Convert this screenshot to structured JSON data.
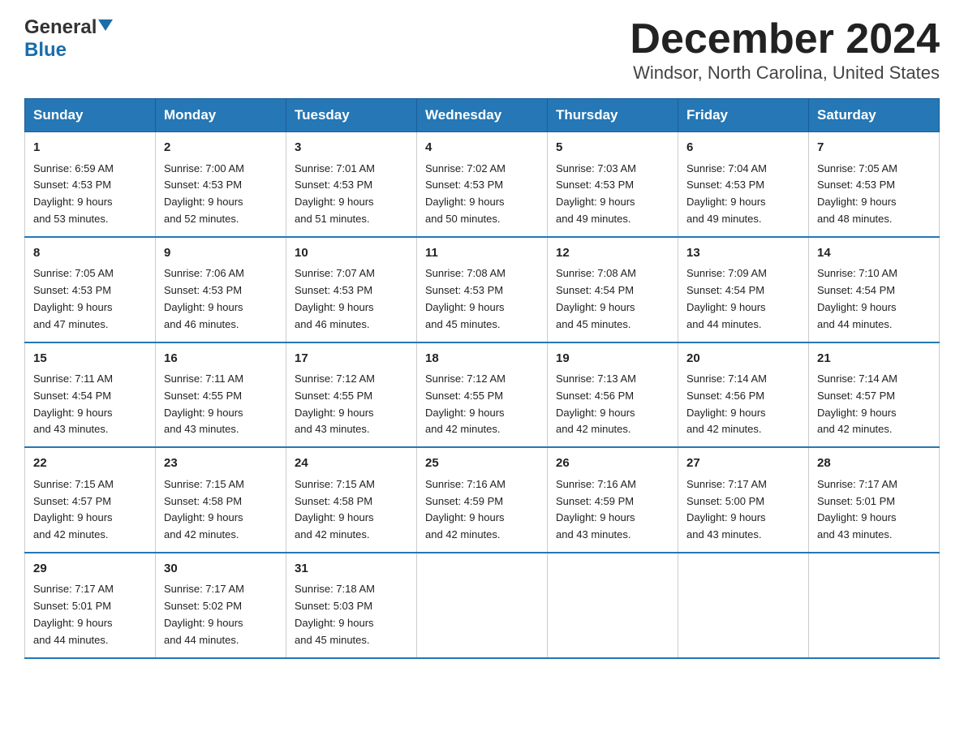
{
  "header": {
    "logo_general": "General",
    "logo_blue": "Blue",
    "title": "December 2024",
    "subtitle": "Windsor, North Carolina, United States"
  },
  "days_of_week": [
    "Sunday",
    "Monday",
    "Tuesday",
    "Wednesday",
    "Thursday",
    "Friday",
    "Saturday"
  ],
  "weeks": [
    [
      {
        "day": "1",
        "sunrise": "6:59 AM",
        "sunset": "4:53 PM",
        "daylight": "9 hours and 53 minutes."
      },
      {
        "day": "2",
        "sunrise": "7:00 AM",
        "sunset": "4:53 PM",
        "daylight": "9 hours and 52 minutes."
      },
      {
        "day": "3",
        "sunrise": "7:01 AM",
        "sunset": "4:53 PM",
        "daylight": "9 hours and 51 minutes."
      },
      {
        "day": "4",
        "sunrise": "7:02 AM",
        "sunset": "4:53 PM",
        "daylight": "9 hours and 50 minutes."
      },
      {
        "day": "5",
        "sunrise": "7:03 AM",
        "sunset": "4:53 PM",
        "daylight": "9 hours and 49 minutes."
      },
      {
        "day": "6",
        "sunrise": "7:04 AM",
        "sunset": "4:53 PM",
        "daylight": "9 hours and 49 minutes."
      },
      {
        "day": "7",
        "sunrise": "7:05 AM",
        "sunset": "4:53 PM",
        "daylight": "9 hours and 48 minutes."
      }
    ],
    [
      {
        "day": "8",
        "sunrise": "7:05 AM",
        "sunset": "4:53 PM",
        "daylight": "9 hours and 47 minutes."
      },
      {
        "day": "9",
        "sunrise": "7:06 AM",
        "sunset": "4:53 PM",
        "daylight": "9 hours and 46 minutes."
      },
      {
        "day": "10",
        "sunrise": "7:07 AM",
        "sunset": "4:53 PM",
        "daylight": "9 hours and 46 minutes."
      },
      {
        "day": "11",
        "sunrise": "7:08 AM",
        "sunset": "4:53 PM",
        "daylight": "9 hours and 45 minutes."
      },
      {
        "day": "12",
        "sunrise": "7:08 AM",
        "sunset": "4:54 PM",
        "daylight": "9 hours and 45 minutes."
      },
      {
        "day": "13",
        "sunrise": "7:09 AM",
        "sunset": "4:54 PM",
        "daylight": "9 hours and 44 minutes."
      },
      {
        "day": "14",
        "sunrise": "7:10 AM",
        "sunset": "4:54 PM",
        "daylight": "9 hours and 44 minutes."
      }
    ],
    [
      {
        "day": "15",
        "sunrise": "7:11 AM",
        "sunset": "4:54 PM",
        "daylight": "9 hours and 43 minutes."
      },
      {
        "day": "16",
        "sunrise": "7:11 AM",
        "sunset": "4:55 PM",
        "daylight": "9 hours and 43 minutes."
      },
      {
        "day": "17",
        "sunrise": "7:12 AM",
        "sunset": "4:55 PM",
        "daylight": "9 hours and 43 minutes."
      },
      {
        "day": "18",
        "sunrise": "7:12 AM",
        "sunset": "4:55 PM",
        "daylight": "9 hours and 42 minutes."
      },
      {
        "day": "19",
        "sunrise": "7:13 AM",
        "sunset": "4:56 PM",
        "daylight": "9 hours and 42 minutes."
      },
      {
        "day": "20",
        "sunrise": "7:14 AM",
        "sunset": "4:56 PM",
        "daylight": "9 hours and 42 minutes."
      },
      {
        "day": "21",
        "sunrise": "7:14 AM",
        "sunset": "4:57 PM",
        "daylight": "9 hours and 42 minutes."
      }
    ],
    [
      {
        "day": "22",
        "sunrise": "7:15 AM",
        "sunset": "4:57 PM",
        "daylight": "9 hours and 42 minutes."
      },
      {
        "day": "23",
        "sunrise": "7:15 AM",
        "sunset": "4:58 PM",
        "daylight": "9 hours and 42 minutes."
      },
      {
        "day": "24",
        "sunrise": "7:15 AM",
        "sunset": "4:58 PM",
        "daylight": "9 hours and 42 minutes."
      },
      {
        "day": "25",
        "sunrise": "7:16 AM",
        "sunset": "4:59 PM",
        "daylight": "9 hours and 42 minutes."
      },
      {
        "day": "26",
        "sunrise": "7:16 AM",
        "sunset": "4:59 PM",
        "daylight": "9 hours and 43 minutes."
      },
      {
        "day": "27",
        "sunrise": "7:17 AM",
        "sunset": "5:00 PM",
        "daylight": "9 hours and 43 minutes."
      },
      {
        "day": "28",
        "sunrise": "7:17 AM",
        "sunset": "5:01 PM",
        "daylight": "9 hours and 43 minutes."
      }
    ],
    [
      {
        "day": "29",
        "sunrise": "7:17 AM",
        "sunset": "5:01 PM",
        "daylight": "9 hours and 44 minutes."
      },
      {
        "day": "30",
        "sunrise": "7:17 AM",
        "sunset": "5:02 PM",
        "daylight": "9 hours and 44 minutes."
      },
      {
        "day": "31",
        "sunrise": "7:18 AM",
        "sunset": "5:03 PM",
        "daylight": "9 hours and 45 minutes."
      },
      null,
      null,
      null,
      null
    ]
  ],
  "labels": {
    "sunrise": "Sunrise:",
    "sunset": "Sunset:",
    "daylight": "Daylight:"
  }
}
